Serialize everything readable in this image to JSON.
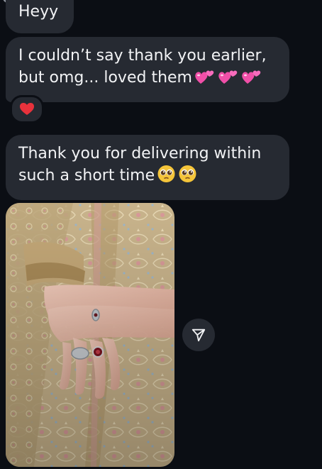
{
  "messages": [
    {
      "lines": [
        "Heyy"
      ]
    },
    {
      "lines": [
        "I couldn’t say thank you earlier,",
        "but omg... loved them"
      ],
      "trailing_emoji": [
        "two-hearts",
        "two-hearts",
        "two-hearts"
      ]
    },
    {
      "lines": [
        "Thank you for delivering within",
        "such a short time"
      ],
      "trailing_emoji": [
        "pleading-face",
        "pleading-face"
      ]
    }
  ],
  "reaction": {
    "emoji": "red-heart"
  },
  "photo": {
    "subject": "hands-with-rings-on-embroidered-outfit"
  },
  "share_button": {
    "icon": "send-icon"
  },
  "colors": {
    "background": "#0b0e14",
    "bubble": "#262a32",
    "text": "#f2f3f5",
    "heart": "#e8323c",
    "two_hearts": "#f04fa8",
    "pleading_face": "#f5c53a"
  }
}
